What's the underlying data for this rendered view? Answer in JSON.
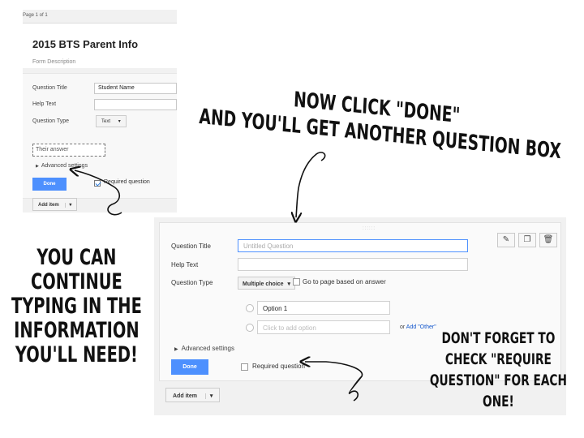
{
  "panel1": {
    "page_label": "Page 1 of 1",
    "form_title": "2015 BTS Parent Info",
    "form_description": "Form Description",
    "question_title_label": "Question Title",
    "question_title_value": "Student Name",
    "help_text_label": "Help Text",
    "question_type_label": "Question Type",
    "question_type_value": "Text",
    "answer_placeholder": "Their answer",
    "advanced_settings": "Advanced settings",
    "done_label": "Done",
    "required_label": "Required question",
    "required_checked": true,
    "add_item_label": "Add item"
  },
  "panel2": {
    "question_title_label": "Question Title",
    "question_title_placeholder": "Untitled Question",
    "help_text_label": "Help Text",
    "question_type_label": "Question Type",
    "question_type_value": "Multiple choice",
    "go_to_page_label": "Go to page based on answer",
    "option1_value": "Option 1",
    "add_option_placeholder": "Click to add option",
    "or_label": "or",
    "add_other_label": "Add \"Other\"",
    "advanced_settings": "Advanced settings",
    "done_label": "Done",
    "required_label": "Required question",
    "required_checked": false,
    "add_item_label": "Add item",
    "icons": [
      "pencil-icon",
      "copy-icon",
      "trash-icon"
    ]
  },
  "annotations": {
    "done_note_line1": "Now click \"done\"",
    "done_note_line2": "and you'll get another question box",
    "continue_note": [
      "You can",
      "continue",
      "typing in the",
      "information",
      "you'll need!"
    ],
    "require_note": [
      "Don't forget to",
      "check \"require",
      "question\" for each",
      "one!"
    ]
  }
}
